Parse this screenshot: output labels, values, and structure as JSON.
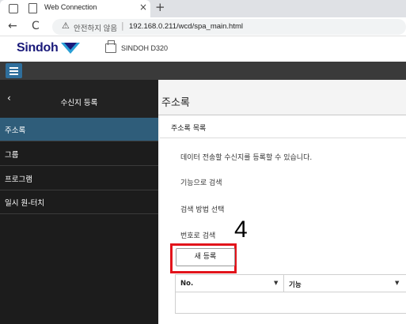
{
  "browser": {
    "tab_title": "Web Connection",
    "tab_close": "×",
    "new_tab": "+",
    "back": "←",
    "reload": "C",
    "security_label": "안전하지 않음",
    "url": "192.168.0.211/wcd/spa_main.html"
  },
  "header": {
    "brand": "Sindoh",
    "brand_color": "#1a1a7a",
    "device_name": "SINDOH D320"
  },
  "sidebar": {
    "back_icon": "‹",
    "title": "수신지 등록",
    "items": [
      {
        "label": "주소록",
        "active": true
      },
      {
        "label": "그룹",
        "active": false
      },
      {
        "label": "프로그램",
        "active": false
      },
      {
        "label": "일시 원-터치",
        "active": false
      }
    ]
  },
  "main": {
    "title": "주소록",
    "panel_title": "주소록 목록",
    "description": "데이터 전송할 수신지를 등록할 수 있습니다.",
    "search_by_function": "기능으로 검색",
    "search_method": "검색 방법 선택",
    "search_by_number": "번호로 검색",
    "callout_number": "4",
    "new_button": "새 등록",
    "highlight_color": "#e2141b",
    "table": {
      "columns": [
        "No.",
        "기능"
      ],
      "caret": "▼"
    }
  }
}
